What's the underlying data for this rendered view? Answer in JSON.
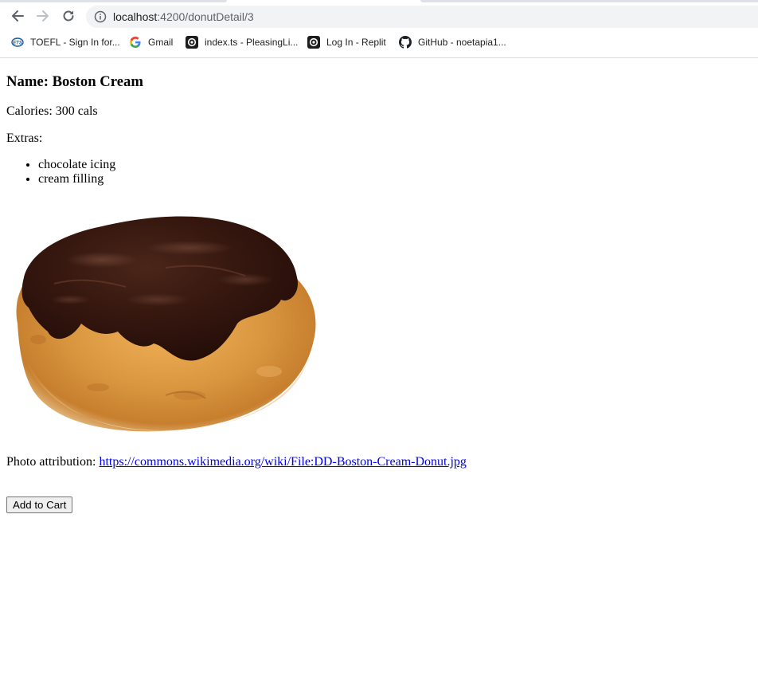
{
  "browser": {
    "url_host": "localhost",
    "url_path": ":4200/donutDetail/3",
    "bookmarks": [
      {
        "icon": "ets-icon",
        "label": "TOEFL - Sign In for..."
      },
      {
        "icon": "google-icon",
        "label": "Gmail"
      },
      {
        "icon": "replit-icon",
        "label": "index.ts - PleasingLi..."
      },
      {
        "icon": "replit-icon",
        "label": "Log In - Replit"
      },
      {
        "icon": "github-icon",
        "label": "GitHub - noetapia1..."
      }
    ]
  },
  "donut": {
    "name_heading": "Name: Boston Cream",
    "calories": "Calories: 300 cals",
    "extras_label": "Extras:",
    "extras": [
      "chocolate icing",
      "cream filling"
    ],
    "image_icon": "boston-cream-donut-image",
    "attribution_label": "Photo attribution: ",
    "attribution_link": "https://commons.wikimedia.org/wiki/File:DD-Boston-Cream-Donut.jpg",
    "add_to_cart": "Add to Cart"
  },
  "colors": {
    "link": "#0000ee",
    "chocolate": "#2b120c",
    "dough": "#d9963f"
  }
}
